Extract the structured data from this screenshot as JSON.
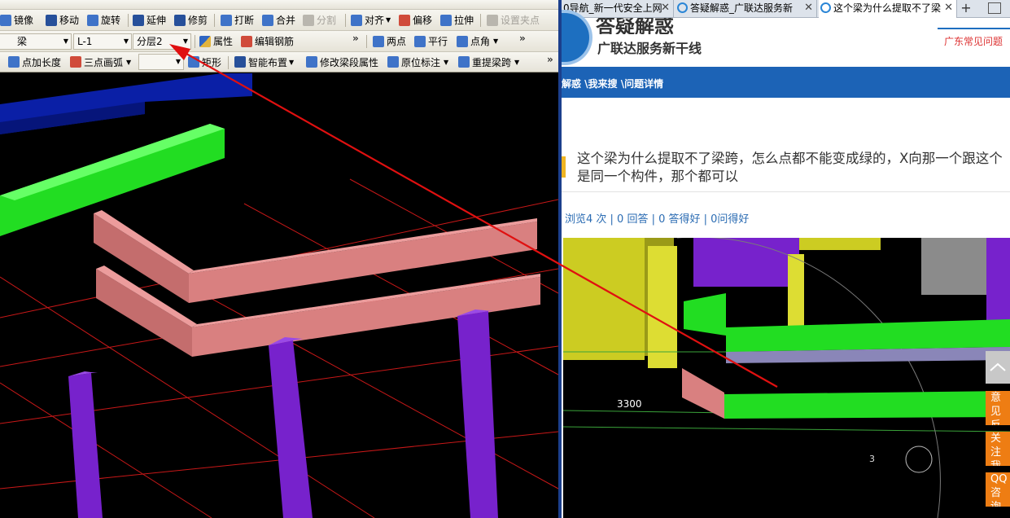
{
  "cad": {
    "toolbar_row1": [
      {
        "label": "镜像",
        "icon": "mirror-icon"
      },
      {
        "label": "移动",
        "icon": "move-icon"
      },
      {
        "label": "旋转",
        "icon": "rotate-icon"
      },
      {
        "label": "延伸",
        "icon": "extend-icon"
      },
      {
        "label": "修剪",
        "icon": "trim-icon"
      },
      {
        "label": "打断",
        "icon": "break-icon"
      },
      {
        "label": "合并",
        "icon": "merge-icon"
      },
      {
        "label": "分割",
        "icon": "split-icon"
      },
      {
        "label": "对齐",
        "icon": "align-icon"
      },
      {
        "label": "偏移",
        "icon": "offset-icon"
      },
      {
        "label": "拉伸",
        "icon": "stretch-icon"
      },
      {
        "label": "设置夹点",
        "icon": "grip-icon"
      }
    ],
    "toolbar_row2": {
      "element_type": "梁",
      "element_name": "L-1",
      "layer": "分层2",
      "property_label": "属性",
      "edit_rebar_label": "编辑钢筋",
      "two_point_label": "两点",
      "parallel_label": "平行",
      "point_angle_label": "点角"
    },
    "toolbar_row3": {
      "point_length_label": "点加长度",
      "three_point_arc_label": "三点画弧",
      "rectangle_label": "矩形",
      "smart_layout_label": "智能布置",
      "modify_span_attr_label": "修改梁段属性",
      "in_situ_label_label": "原位标注",
      "re_extract_span_label": "重提梁跨"
    }
  },
  "browser": {
    "tabs": [
      {
        "label": "0导航_新一代安全上网",
        "active": false
      },
      {
        "label": "答疑解惑_广联达服务新",
        "active": false
      },
      {
        "label": "这个梁为什么提取不了梁",
        "active": true
      }
    ],
    "new_tab": "+",
    "site": {
      "title": "答疑解惑",
      "subtitle": "广联达服务新干线",
      "faq_link": "广东常见问题",
      "breadcrumb": "解惑 \\我来搜 \\问题详情"
    },
    "question": {
      "title": "这个梁为什么提取不了梁跨，怎么点都不能变成绿的，X向那一个跟这个是同一个构件，那个都可以",
      "stats": "浏览4 次 | 0 回答 | 0 答得好 | 0问得好"
    },
    "image_label": "3300",
    "image_axis_label": "3",
    "side_buttons": [
      {
        "label": "意见反馈"
      },
      {
        "label": "关注我们"
      },
      {
        "label": "QQ咨询"
      }
    ]
  },
  "colors": {
    "beam_green": "#22dd22",
    "beam_pink": "#d98080",
    "column_purple": "#7722cc",
    "annotation_arrow": "#e01010",
    "nav_blue": "#1c63b6",
    "side_orange": "#ee7d13"
  }
}
